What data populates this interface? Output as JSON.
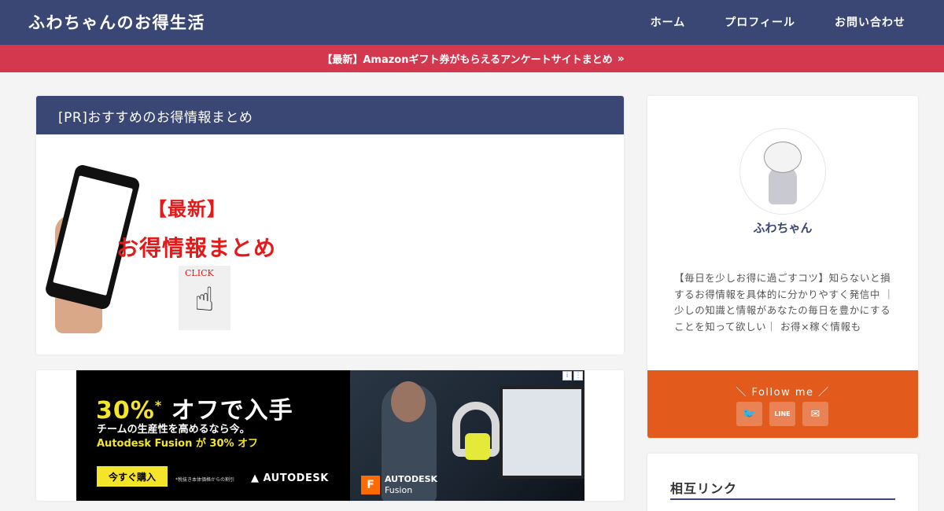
{
  "header": {
    "site_title": "ふわちゃんのお得生活",
    "nav": [
      "ホーム",
      "プロフィール",
      "お問い合わせ"
    ]
  },
  "notice": {
    "text": "【最新】Amazonギフト券がもらえるアンケートサイトまとめ",
    "chevron": "»"
  },
  "pr_card": {
    "title": "[PR]おすすめのお得情報まとめ",
    "image_line1": "【最新】",
    "image_line2": "お得情報まとめ",
    "image_click": "CLICK"
  },
  "ad": {
    "headline_pct": "30%",
    "headline_star": "*",
    "headline_rest": " オフで入手",
    "sub1": "チームの生産性を高めるなら今。",
    "sub2": "Autodesk Fusion が 30% オフ",
    "button": "今すぐ購入",
    "note": "*税抜き本体価格からの割引",
    "brand": "▲ AUTODESK",
    "fusion_logo": "F",
    "fusion_brand": "AUTODESK",
    "fusion_product": "Fusion",
    "info_icon": "i",
    "more_icon": "⋮"
  },
  "profile": {
    "name": "ふわちゃん",
    "description": "【毎日を少しお得に過ごすコツ】知らないと損するお得情報を具体的に分かりやすく発信中 ｜少しの知識と情報があなたの毎日を豊かにすることを知って欲しい｜ お得×稼ぐ情報も"
  },
  "follow": {
    "title": "＼ Follow me ／",
    "icons": [
      "twitter-icon",
      "line-icon",
      "mail-icon"
    ],
    "glyphs": [
      "🐦",
      "LINE",
      "✉"
    ]
  },
  "links": {
    "title": "相互リンク"
  },
  "colors": {
    "primary": "#3a4674",
    "notice": "#d3384f",
    "follow": "#e25a1c",
    "ad_yellow": "#f5e52a",
    "pr_red": "#e21a1a"
  }
}
